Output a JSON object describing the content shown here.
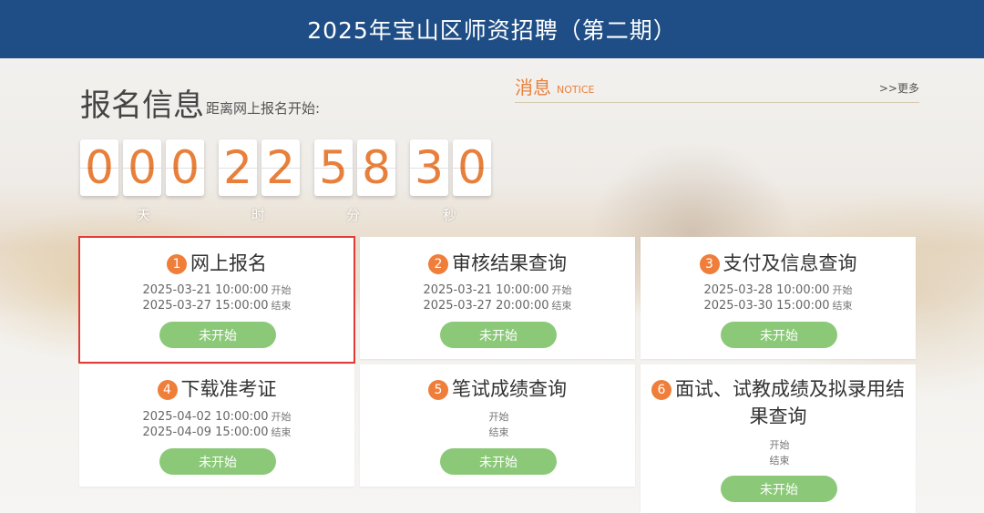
{
  "header": {
    "title": "2025年宝山区师资招聘（第二期）"
  },
  "registration": {
    "title": "报名信息",
    "subtitle": "距离网上报名开始:",
    "countdown": {
      "days": [
        "0",
        "0",
        "0"
      ],
      "hours": [
        "2",
        "2"
      ],
      "minutes": [
        "5",
        "8"
      ],
      "seconds": [
        "3",
        "0"
      ],
      "units": [
        "天",
        "时",
        "分",
        "秒"
      ]
    }
  },
  "notice": {
    "title": "消息",
    "subtitle": "NOTICE",
    "more": ">>更多"
  },
  "colors": {
    "header_bg": "#1f4e86",
    "accent": "#e8803c",
    "button": "#8bc979",
    "highlight_border": "#e03b35"
  },
  "stages": [
    {
      "num": "1",
      "title": "网上报名",
      "start": "2025-03-21 10:00:00",
      "end": "2025-03-27 15:00:00",
      "start_label": "开始",
      "end_label": "结束",
      "status": "未开始"
    },
    {
      "num": "2",
      "title": "审核结果查询",
      "start": "2025-03-21 10:00:00",
      "end": "2025-03-27 20:00:00",
      "start_label": "开始",
      "end_label": "结束",
      "status": "未开始"
    },
    {
      "num": "3",
      "title": "支付及信息查询",
      "start": "2025-03-28 10:00:00",
      "end": "2025-03-30 15:00:00",
      "start_label": "开始",
      "end_label": "结束",
      "status": "未开始"
    },
    {
      "num": "4",
      "title": "下载准考证",
      "start": "2025-04-02 10:00:00",
      "end": "2025-04-09 15:00:00",
      "start_label": "开始",
      "end_label": "结束",
      "status": "未开始"
    },
    {
      "num": "5",
      "title": "笔试成绩查询",
      "start": "",
      "end": "",
      "start_label": "开始",
      "end_label": "结束",
      "status": "未开始"
    },
    {
      "num": "6",
      "title_line1": "面试、试教成绩及拟录用结",
      "title_line2": "果查询",
      "start": "",
      "end": "",
      "start_label": "开始",
      "end_label": "结束",
      "status": "未开始"
    }
  ]
}
